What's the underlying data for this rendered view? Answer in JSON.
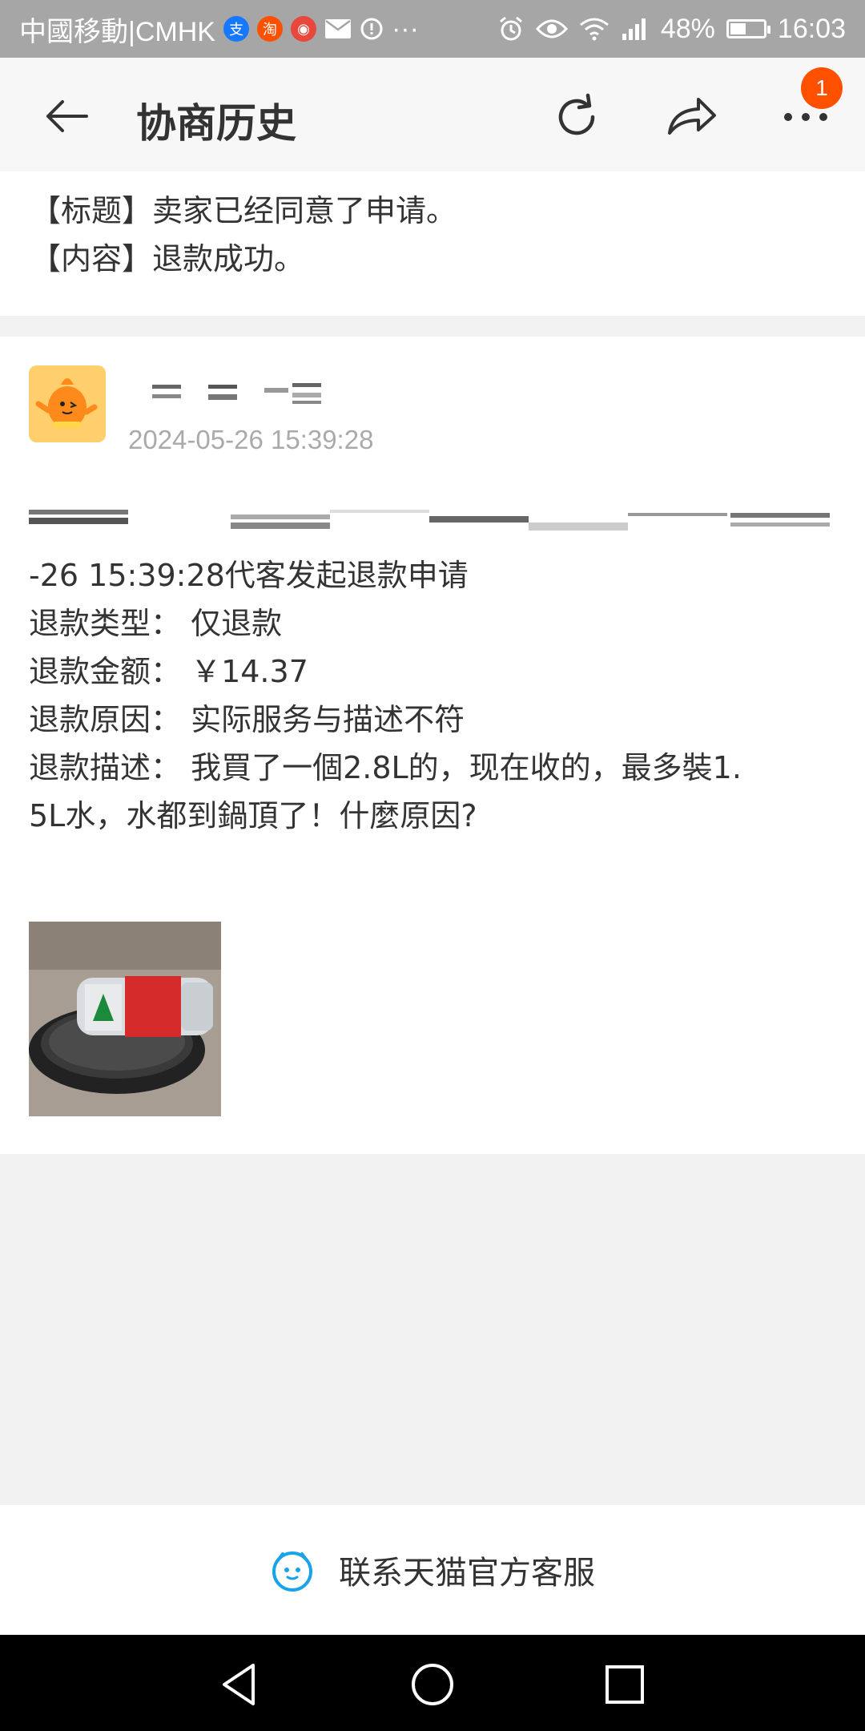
{
  "status_bar": {
    "carrier": "中國移動|CMHK",
    "overflow": "···",
    "battery_text": "48%",
    "battery_level": 0.48,
    "time": "16:03"
  },
  "header": {
    "title": "协商历史",
    "badge_count": "1"
  },
  "summary": {
    "title_line": "【标题】卖家已经同意了申请。",
    "content_line": "【内容】退款成功。"
  },
  "message": {
    "timestamp": "2024-05-26 15:39:28",
    "lines": [
      "-26 15:39:28代客发起退款申请",
      "退款类型： 仅退款",
      "退款金额： ￥14.37",
      "退款原因： 实际服务与描述不符",
      "退款描述： 我買了一個2.8L的，现在收的，最多裝1.",
      "5L水，水都到鍋頂了！什麼原因?"
    ]
  },
  "footer": {
    "contact_label": "联系天猫官方客服"
  },
  "colors": {
    "accent": "#ff5000",
    "status_bar": "#a6a6a6",
    "service_icon": "#1aa3e8"
  }
}
